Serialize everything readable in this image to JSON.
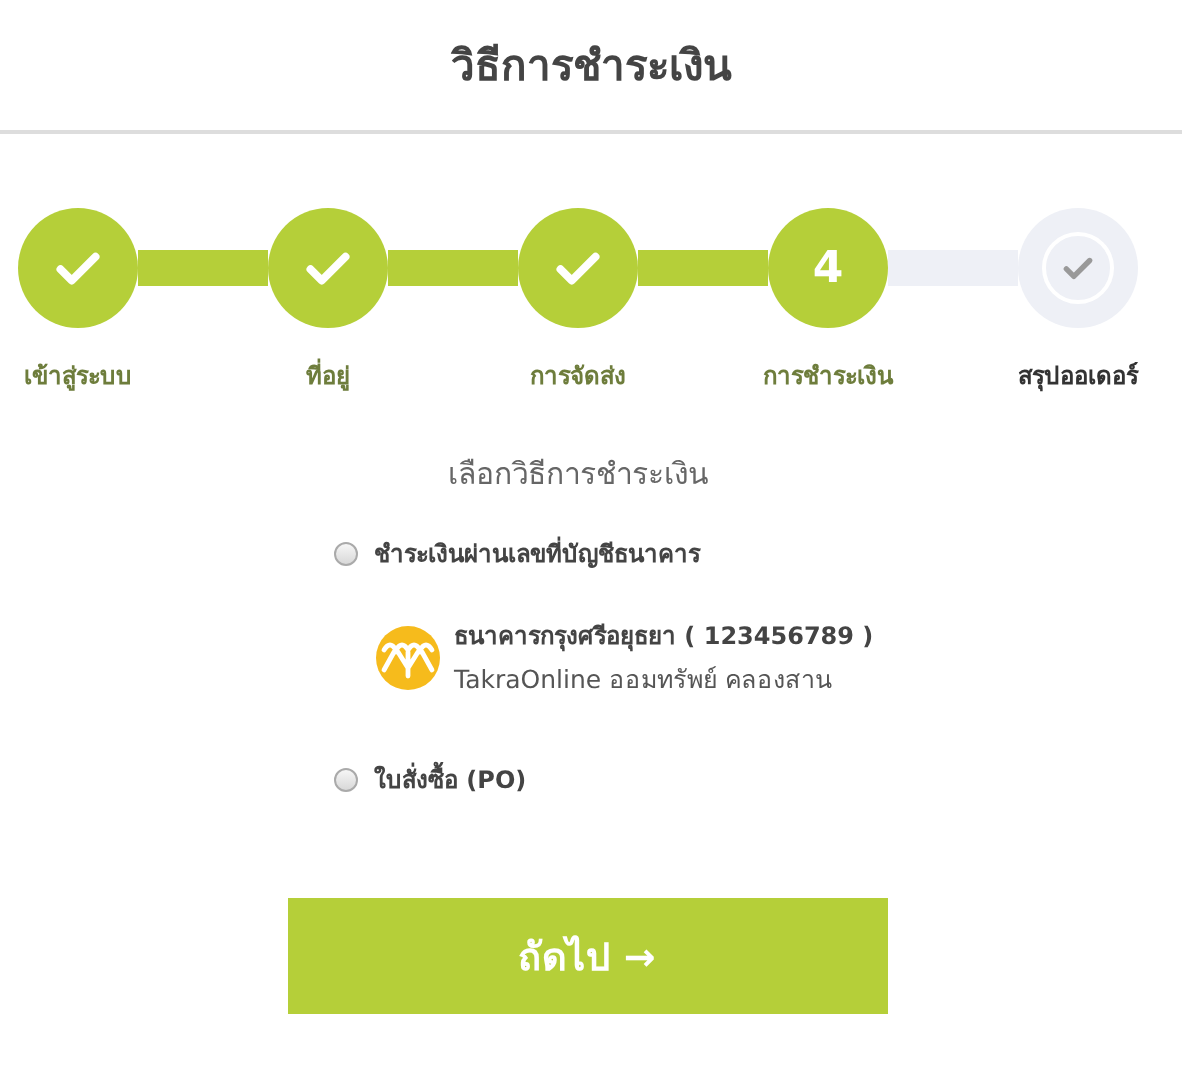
{
  "header": {
    "title": "วิธีการชำระเงิน"
  },
  "steps": [
    {
      "label": "เข้าสู่ระบบ",
      "completed": true,
      "selected": false
    },
    {
      "label": "ที่อยู่",
      "completed": true,
      "selected": false
    },
    {
      "label": "การจัดส่ง",
      "completed": true,
      "selected": false
    },
    {
      "label": "การชำระเงิน",
      "completed": false,
      "selected": true,
      "number": "4"
    },
    {
      "label": "สรุปออเดอร์",
      "completed": false,
      "selected": false
    }
  ],
  "payment": {
    "heading": "เลือกวิธีการชำระเงิน",
    "options": [
      {
        "label": "ชำระเงินผ่านเลขที่บัญชีธนาคาร",
        "selected": false,
        "bank": {
          "name": "ธนาคารกรุงศรีอยุธยา ( 123456789 )",
          "account": "TakraOnline ออมทรัพย์ คลองสาน"
        }
      },
      {
        "label": "ใบสั่งซื้อ (PO)",
        "selected": false
      }
    ]
  },
  "next_button": {
    "label": "ถัดไป →"
  }
}
